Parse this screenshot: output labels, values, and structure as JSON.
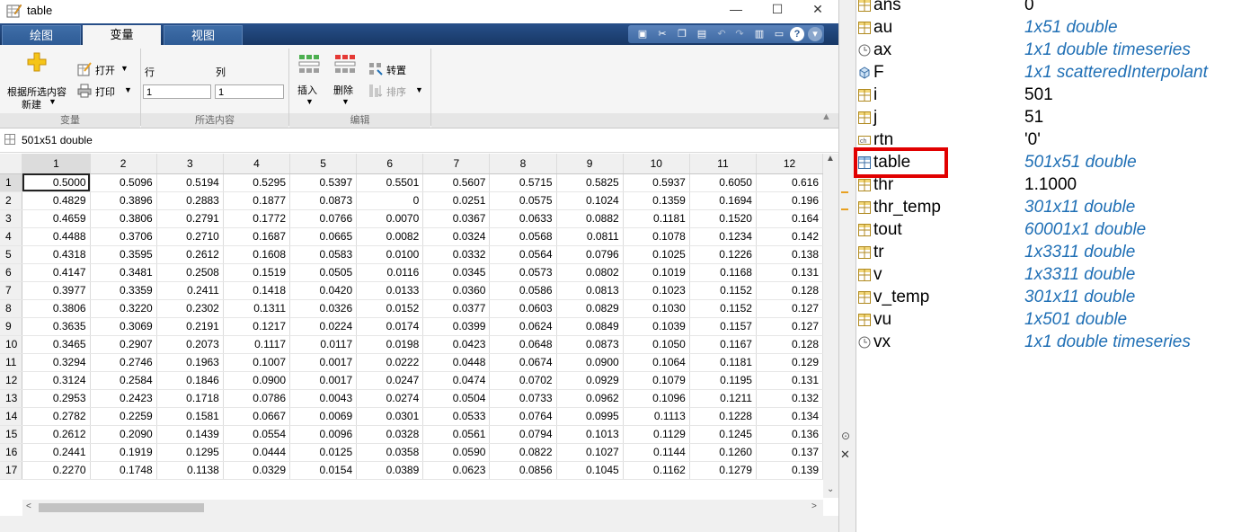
{
  "window": {
    "title": "table",
    "controls": {
      "minimize": "—",
      "maximize": "☐",
      "close": "✕"
    }
  },
  "tabs": [
    {
      "label": "绘图",
      "active": false
    },
    {
      "label": "变量",
      "active": true
    },
    {
      "label": "视图",
      "active": false
    }
  ],
  "ribbon": {
    "new_from_selection_line1": "根据所选内容",
    "new_from_selection_line2": "新建",
    "open": "打开",
    "print": "打印",
    "row_label": "行",
    "col_label": "列",
    "row_value": "1",
    "col_value": "1",
    "insert": "插入",
    "delete": "删除",
    "transpose": "转置",
    "sort": "排序",
    "group_variable": "变量",
    "group_selection": "所选内容",
    "group_edit": "编辑"
  },
  "variable_path": "501x51 double",
  "grid": {
    "col_headers": [
      "1",
      "2",
      "3",
      "4",
      "5",
      "6",
      "7",
      "8",
      "9",
      "10",
      "11",
      "12"
    ],
    "row_headers": [
      "1",
      "2",
      "3",
      "4",
      "5",
      "6",
      "7",
      "8",
      "9",
      "10",
      "11",
      "12",
      "13",
      "14",
      "15",
      "16",
      "17"
    ],
    "rows": [
      [
        "0.5000",
        "0.5096",
        "0.5194",
        "0.5295",
        "0.5397",
        "0.5501",
        "0.5607",
        "0.5715",
        "0.5825",
        "0.5937",
        "0.6050",
        "0.616"
      ],
      [
        "0.4829",
        "0.3896",
        "0.2883",
        "0.1877",
        "0.0873",
        "0",
        "0.0251",
        "0.0575",
        "0.1024",
        "0.1359",
        "0.1694",
        "0.196"
      ],
      [
        "0.4659",
        "0.3806",
        "0.2791",
        "0.1772",
        "0.0766",
        "0.0070",
        "0.0367",
        "0.0633",
        "0.0882",
        "0.1181",
        "0.1520",
        "0.164"
      ],
      [
        "0.4488",
        "0.3706",
        "0.2710",
        "0.1687",
        "0.0665",
        "0.0082",
        "0.0324",
        "0.0568",
        "0.0811",
        "0.1078",
        "0.1234",
        "0.142"
      ],
      [
        "0.4318",
        "0.3595",
        "0.2612",
        "0.1608",
        "0.0583",
        "0.0100",
        "0.0332",
        "0.0564",
        "0.0796",
        "0.1025",
        "0.1226",
        "0.138"
      ],
      [
        "0.4147",
        "0.3481",
        "0.2508",
        "0.1519",
        "0.0505",
        "0.0116",
        "0.0345",
        "0.0573",
        "0.0802",
        "0.1019",
        "0.1168",
        "0.131"
      ],
      [
        "0.3977",
        "0.3359",
        "0.2411",
        "0.1418",
        "0.0420",
        "0.0133",
        "0.0360",
        "0.0586",
        "0.0813",
        "0.1023",
        "0.1152",
        "0.128"
      ],
      [
        "0.3806",
        "0.3220",
        "0.2302",
        "0.1311",
        "0.0326",
        "0.0152",
        "0.0377",
        "0.0603",
        "0.0829",
        "0.1030",
        "0.1152",
        "0.127"
      ],
      [
        "0.3635",
        "0.3069",
        "0.2191",
        "0.1217",
        "0.0224",
        "0.0174",
        "0.0399",
        "0.0624",
        "0.0849",
        "0.1039",
        "0.1157",
        "0.127"
      ],
      [
        "0.3465",
        "0.2907",
        "0.2073",
        "0.1117",
        "0.0117",
        "0.0198",
        "0.0423",
        "0.0648",
        "0.0873",
        "0.1050",
        "0.1167",
        "0.128"
      ],
      [
        "0.3294",
        "0.2746",
        "0.1963",
        "0.1007",
        "0.0017",
        "0.0222",
        "0.0448",
        "0.0674",
        "0.0900",
        "0.1064",
        "0.1181",
        "0.129"
      ],
      [
        "0.3124",
        "0.2584",
        "0.1846",
        "0.0900",
        "0.0017",
        "0.0247",
        "0.0474",
        "0.0702",
        "0.0929",
        "0.1079",
        "0.1195",
        "0.131"
      ],
      [
        "0.2953",
        "0.2423",
        "0.1718",
        "0.0786",
        "0.0043",
        "0.0274",
        "0.0504",
        "0.0733",
        "0.0962",
        "0.1096",
        "0.1211",
        "0.132"
      ],
      [
        "0.2782",
        "0.2259",
        "0.1581",
        "0.0667",
        "0.0069",
        "0.0301",
        "0.0533",
        "0.0764",
        "0.0995",
        "0.1113",
        "0.1228",
        "0.134"
      ],
      [
        "0.2612",
        "0.2090",
        "0.1439",
        "0.0554",
        "0.0096",
        "0.0328",
        "0.0561",
        "0.0794",
        "0.1013",
        "0.1129",
        "0.1245",
        "0.136"
      ],
      [
        "0.2441",
        "0.1919",
        "0.1295",
        "0.0444",
        "0.0125",
        "0.0358",
        "0.0590",
        "0.0822",
        "0.1027",
        "0.1144",
        "0.1260",
        "0.137"
      ],
      [
        "0.2270",
        "0.1748",
        "0.1138",
        "0.0329",
        "0.0154",
        "0.0389",
        "0.0623",
        "0.0856",
        "0.1045",
        "0.1162",
        "0.1279",
        "0.139"
      ]
    ]
  },
  "workspace": [
    {
      "name": "ans",
      "value": "0",
      "icon": "matrix-icon",
      "type": "plain"
    },
    {
      "name": "au",
      "value": "1x51 double",
      "icon": "matrix-icon",
      "type": "desc"
    },
    {
      "name": "ax",
      "value": "1x1 double timeseries",
      "icon": "timeseries-icon",
      "type": "desc"
    },
    {
      "name": "F",
      "value": "1x1 scatteredInterpolant",
      "icon": "object-icon",
      "type": "desc"
    },
    {
      "name": "i",
      "value": "501",
      "icon": "matrix-icon",
      "type": "plain"
    },
    {
      "name": "j",
      "value": "51",
      "icon": "matrix-icon",
      "type": "plain"
    },
    {
      "name": "rtn",
      "value": "'0'",
      "icon": "char-icon",
      "type": "plain"
    },
    {
      "name": "table",
      "value": "501x51 double",
      "icon": "matrix-icon",
      "type": "desc",
      "selected": true
    },
    {
      "name": "thr",
      "value": "1.1000",
      "icon": "matrix-icon",
      "type": "plain"
    },
    {
      "name": "thr_temp",
      "value": "301x11 double",
      "icon": "matrix-icon",
      "type": "desc"
    },
    {
      "name": "tout",
      "value": "60001x1 double",
      "icon": "matrix-icon",
      "type": "desc"
    },
    {
      "name": "tr",
      "value": "1x3311 double",
      "icon": "matrix-icon",
      "type": "desc"
    },
    {
      "name": "v",
      "value": "1x3311 double",
      "icon": "matrix-icon",
      "type": "desc"
    },
    {
      "name": "v_temp",
      "value": "301x11 double",
      "icon": "matrix-icon",
      "type": "desc"
    },
    {
      "name": "vu",
      "value": "1x501 double",
      "icon": "matrix-icon",
      "type": "desc"
    },
    {
      "name": "vx",
      "value": "1x1 double timeseries",
      "icon": "timeseries-icon",
      "type": "desc"
    }
  ],
  "colors": {
    "highlight": "#e10000",
    "desc_text": "#1f6fb5",
    "tab_bar": "#1c3c6b"
  }
}
